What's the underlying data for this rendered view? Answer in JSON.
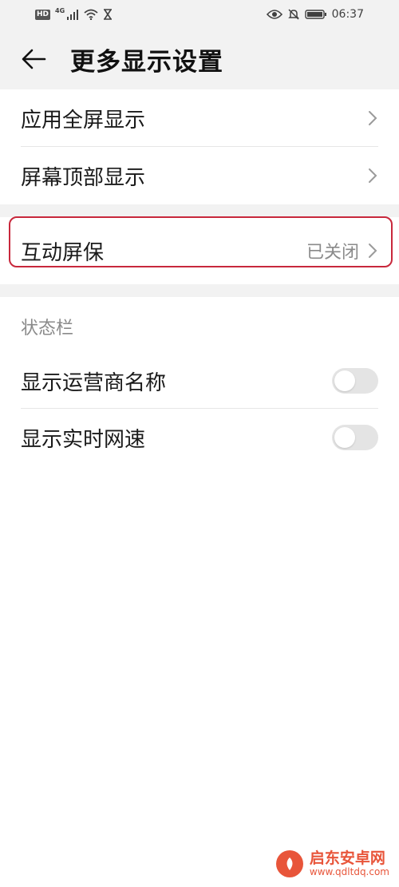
{
  "status_bar": {
    "hd": "HD",
    "network": "4G",
    "time": "06:37"
  },
  "header": {
    "title": "更多显示设置"
  },
  "display_section": [
    {
      "label": "应用全屏显示"
    },
    {
      "label": "屏幕顶部显示"
    }
  ],
  "screensaver": {
    "label": "互动屏保",
    "value": "已关闭"
  },
  "status_section": {
    "title": "状态栏",
    "items": [
      {
        "label": "显示运营商名称",
        "state": "off"
      },
      {
        "label": "显示实时网速",
        "state": "off"
      }
    ]
  },
  "watermark": {
    "name": "启东安卓网",
    "url": "www.qdltdq.com"
  },
  "colors": {
    "highlight": "#c8283c",
    "background_gray": "#f2f2f2",
    "watermark": "#e8553a"
  }
}
